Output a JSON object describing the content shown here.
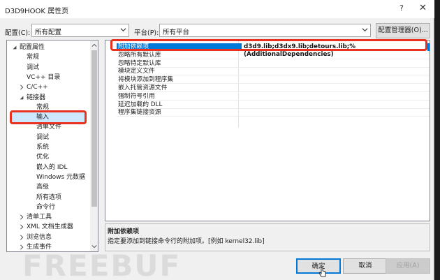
{
  "window": {
    "title": "D3D9HOOK 属性页",
    "help_glyph": "?",
    "close_glyph": "✕"
  },
  "toolbar": {
    "config_label": "配置(C):",
    "config_value": "所有配置",
    "platform_label": "平台(P):",
    "platform_value": "所有平台",
    "config_manager_label": "配置管理器(O)..."
  },
  "tree": {
    "items": [
      {
        "label": "配置属性",
        "expander": "open"
      },
      {
        "label": "常规"
      },
      {
        "label": "调试"
      },
      {
        "label": "VC++ 目录"
      },
      {
        "label": "C/C++",
        "expander": "closed"
      },
      {
        "label": "链接器",
        "expander": "open"
      },
      {
        "label": "常规"
      },
      {
        "label": "输入",
        "selected": true
      },
      {
        "label": "清单文件"
      },
      {
        "label": "调试"
      },
      {
        "label": "系统"
      },
      {
        "label": "优化"
      },
      {
        "label": "嵌入的 IDL"
      },
      {
        "label": "Windows 元数据"
      },
      {
        "label": "高级"
      },
      {
        "label": "所有选项"
      },
      {
        "label": "命令行"
      },
      {
        "label": "清单工具",
        "expander": "closed"
      },
      {
        "label": "XML 文档生成器",
        "expander": "closed"
      },
      {
        "label": "浏览信息",
        "expander": "closed"
      },
      {
        "label": "生成事件",
        "expander": "closed"
      }
    ]
  },
  "properties": {
    "rows": [
      {
        "name": "附加依赖项",
        "value": "d3d9.lib;d3dx9.lib;detours.lib;%(AdditionalDependencies)",
        "selected": true
      },
      {
        "name": "忽略所有默认库",
        "value": ""
      },
      {
        "name": "忽略特定默认库",
        "value": ""
      },
      {
        "name": "模块定义文件",
        "value": ""
      },
      {
        "name": "将模块添加到程序集",
        "value": ""
      },
      {
        "name": "嵌入托管资源文件",
        "value": ""
      },
      {
        "name": "强制符号引用",
        "value": ""
      },
      {
        "name": "延迟加载的 DLL",
        "value": ""
      },
      {
        "name": "程序集链接资源",
        "value": ""
      }
    ]
  },
  "description": {
    "title": "附加依赖项",
    "text": "指定要添加到链接命令行的附加项。[例如 kernel32.lib]"
  },
  "buttons": {
    "ok": "确定",
    "cancel": "取消",
    "apply": "应用(A)"
  },
  "watermark": "FREEBUF",
  "colors": {
    "selection": "#0078d7",
    "highlight_box": "#e8321f",
    "tree_selection": "#cce8ff"
  }
}
